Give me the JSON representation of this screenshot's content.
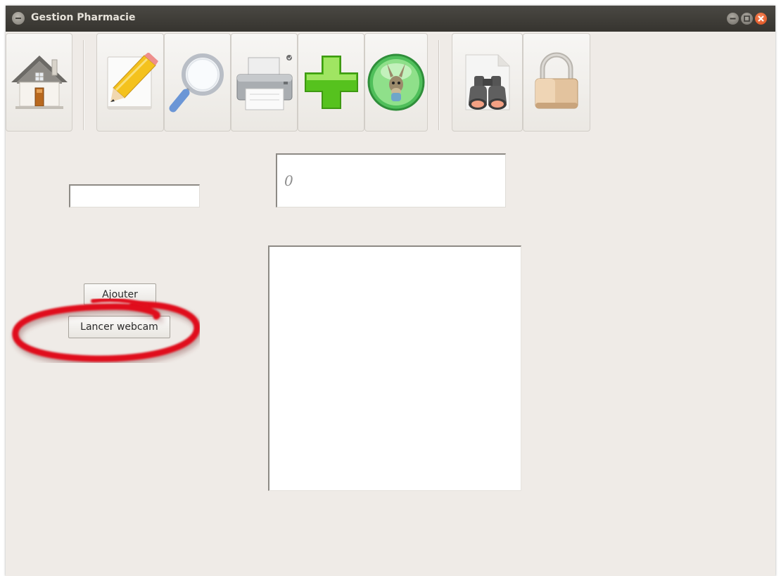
{
  "window": {
    "title": "Gestion Pharmacie"
  },
  "toolbar": {
    "buttons": [
      {
        "icon": "house-icon",
        "name": "home-button"
      },
      {
        "icon": "pencil-document-icon",
        "name": "edit-button"
      },
      {
        "icon": "magnifier-icon",
        "name": "search-button"
      },
      {
        "icon": "printer-icon",
        "name": "print-button"
      },
      {
        "icon": "green-plus-icon",
        "name": "add-button"
      },
      {
        "icon": "emule-donkey-icon",
        "name": "emule-button"
      },
      {
        "icon": "binoculars-document-icon",
        "name": "find-document-button"
      },
      {
        "icon": "padlock-icon",
        "name": "lock-button"
      }
    ]
  },
  "form": {
    "small_input_value": "",
    "big_input_value": "0",
    "add_button_label": "Ajouter",
    "webcam_button_label": "Lancer webcam"
  },
  "annotation": {
    "highlight_color": "#e0101a"
  }
}
